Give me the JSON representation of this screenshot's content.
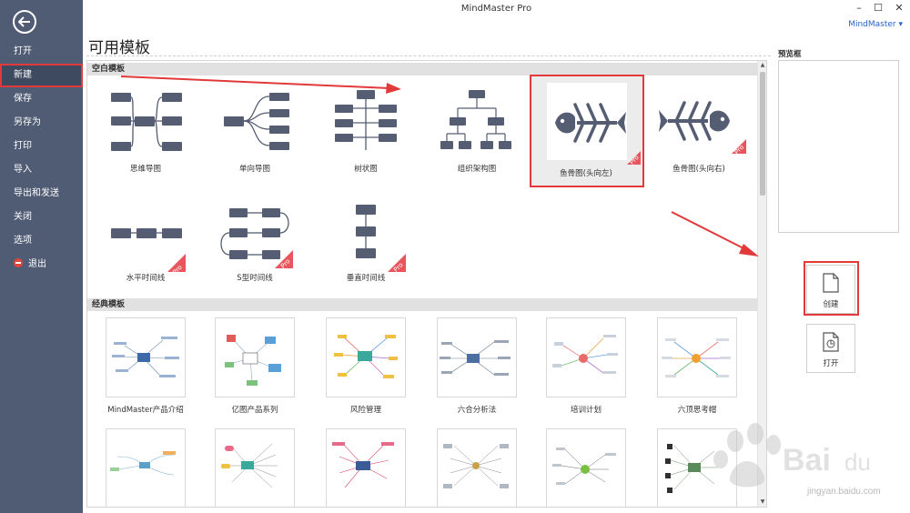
{
  "window": {
    "title": "MindMaster Pro",
    "user": "MindMaster",
    "minimize_icon": "minimize-icon",
    "maximize_icon": "maximize-icon",
    "close_icon": "close-icon"
  },
  "sidebar": {
    "back_icon": "back-arrow-icon",
    "items": [
      {
        "label": "打开"
      },
      {
        "label": "新建",
        "active": true
      },
      {
        "label": "保存"
      },
      {
        "label": "另存为"
      },
      {
        "label": "打印"
      },
      {
        "label": "导入"
      },
      {
        "label": "导出和发送"
      },
      {
        "label": "关闭"
      },
      {
        "label": "选项"
      },
      {
        "label": "退出",
        "icon": "exit-icon"
      }
    ]
  },
  "main": {
    "title": "可用模板",
    "sections": [
      {
        "label": "空白模板",
        "templates": [
          {
            "label": "思维导图",
            "icon": "mindmap-icon"
          },
          {
            "label": "单向导图",
            "icon": "right-map-icon"
          },
          {
            "label": "树状图",
            "icon": "tree-map-icon"
          },
          {
            "label": "组织架构图",
            "icon": "org-chart-icon"
          },
          {
            "label": "鱼骨图(头向左)",
            "icon": "fishbone-left-icon",
            "pro": true,
            "selected": true
          },
          {
            "label": "鱼骨图(头向右)",
            "icon": "fishbone-right-icon",
            "pro": true
          },
          {
            "label": "水平时间线",
            "icon": "horizontal-timeline-icon",
            "pro": true
          },
          {
            "label": "S型时间线",
            "icon": "s-timeline-icon",
            "pro": true
          },
          {
            "label": "垂直时间线",
            "icon": "vertical-timeline-icon",
            "pro": true
          }
        ],
        "pro_text": "Pro"
      },
      {
        "label": "经典模板",
        "templates": [
          {
            "label": "MindMaster产品介绍"
          },
          {
            "label": "亿图产品系列"
          },
          {
            "label": "风险管理"
          },
          {
            "label": "六合分析法"
          },
          {
            "label": "培训计划"
          },
          {
            "label": "六顶思考帽"
          }
        ]
      }
    ]
  },
  "right_pane": {
    "preview_label": "预览框",
    "create_label": "创建",
    "create_icon": "new-document-icon",
    "open_label": "打开",
    "open_icon": "open-file-icon"
  },
  "watermark": {
    "text": "jingyan.baidu.com"
  },
  "colors": {
    "sidebar": "#505c74",
    "shape": "#555d72",
    "highlight": "#e23a3a",
    "pro": "#e8555d",
    "accent_link": "#2a62c9"
  }
}
